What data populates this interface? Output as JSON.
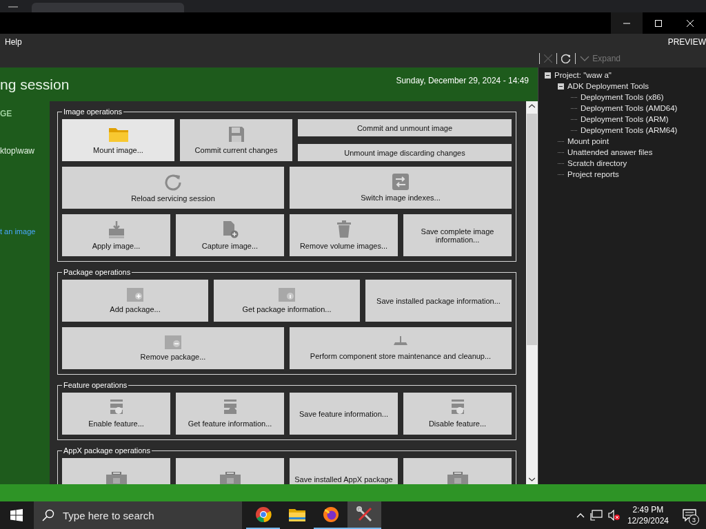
{
  "menu": {
    "left": "Help",
    "right": "PREVIEW"
  },
  "toolbar": {
    "expand": {
      "label": "Expand",
      "disabled": true
    },
    "close_disabled": true
  },
  "header": {
    "title": "ng session",
    "date": "Sunday, December 29, 2024 - 14:49"
  },
  "sidebar": {
    "heading": "GE",
    "path": "ktop\\waw",
    "link": "t an image"
  },
  "groups": [
    {
      "title": "Image operations",
      "rows": [
        [
          {
            "kind": "mount",
            "label": "Mount image...",
            "highlighted": true
          },
          {
            "kind": "commit",
            "label": "Commit current changes",
            "highlighted": false
          },
          {
            "kind": "stack",
            "buttons": [
              {
                "label": "Commit and unmount image",
                "highlighted": false
              },
              {
                "label": "Unmount image discarding changes",
                "highlighted": false
              }
            ]
          }
        ],
        [
          {
            "kind": "reload",
            "label": "Reload servicing session",
            "highlighted": false
          },
          {
            "kind": "switch",
            "label": "Switch image indexes...",
            "highlighted": false
          }
        ],
        [
          {
            "kind": "apply",
            "label": "Apply image...",
            "highlighted": false
          },
          {
            "kind": "capture",
            "label": "Capture image...",
            "highlighted": false
          },
          {
            "kind": "remove",
            "label": "Remove volume images...",
            "highlighted": false
          },
          {
            "kind": "text",
            "label": "Save complete image information...",
            "highlighted": false
          }
        ]
      ]
    },
    {
      "title": "Package operations",
      "rows": [
        [
          {
            "kind": "pkg-add",
            "label": "Add package...",
            "highlighted": false
          },
          {
            "kind": "pkg-info",
            "label": "Get package information...",
            "highlighted": false
          },
          {
            "kind": "text",
            "label": "Save installed package information...",
            "highlighted": false
          }
        ],
        [
          {
            "kind": "pkg-remove",
            "label": "Remove package...",
            "highlighted": false
          },
          {
            "kind": "cleanup",
            "label": "Perform component store maintenance and cleanup...",
            "highlighted": false
          }
        ]
      ]
    },
    {
      "title": "Feature operations",
      "rows": [
        [
          {
            "kind": "feat-enable",
            "label": "Enable feature...",
            "highlighted": false
          },
          {
            "kind": "feat-info",
            "label": "Get feature information...",
            "highlighted": false
          },
          {
            "kind": "text",
            "label": "Save feature information...",
            "highlighted": false
          },
          {
            "kind": "feat-disable",
            "label": "Disable feature...",
            "highlighted": false
          }
        ]
      ]
    },
    {
      "title": "AppX package operations",
      "rows": [
        [
          {
            "kind": "appx",
            "highlighted": false
          },
          {
            "kind": "appx",
            "highlighted": false
          },
          {
            "kind": "text",
            "label": "Save installed AppX package",
            "highlighted": false
          },
          {
            "kind": "appx",
            "highlighted": false
          }
        ]
      ]
    }
  ],
  "tree": [
    {
      "label": "Project: \"waw a\"",
      "expanded": true,
      "children": [
        {
          "label": "ADK Deployment Tools",
          "expanded": true,
          "children": [
            {
              "label": "Deployment Tools (x86)"
            },
            {
              "label": "Deployment Tools (AMD64)"
            },
            {
              "label": "Deployment Tools (ARM)"
            },
            {
              "label": "Deployment Tools (ARM64)"
            }
          ]
        },
        {
          "label": "Mount point"
        },
        {
          "label": "Unattended answer files"
        },
        {
          "label": "Scratch directory"
        },
        {
          "label": "Project reports"
        }
      ]
    }
  ],
  "taskbar": {
    "search": {
      "placeholder": "Type here to search"
    },
    "apps": [
      {
        "kind": "chrome",
        "running": true,
        "selected": false
      },
      {
        "kind": "folder",
        "running": false,
        "selected": false
      },
      {
        "kind": "firefox",
        "running": true,
        "selected": false
      },
      {
        "kind": "tools",
        "running": true,
        "selected": true
      }
    ],
    "volume_muted": true,
    "time": "2:49 PM",
    "date": "12/29/2024",
    "notifications": "3"
  }
}
